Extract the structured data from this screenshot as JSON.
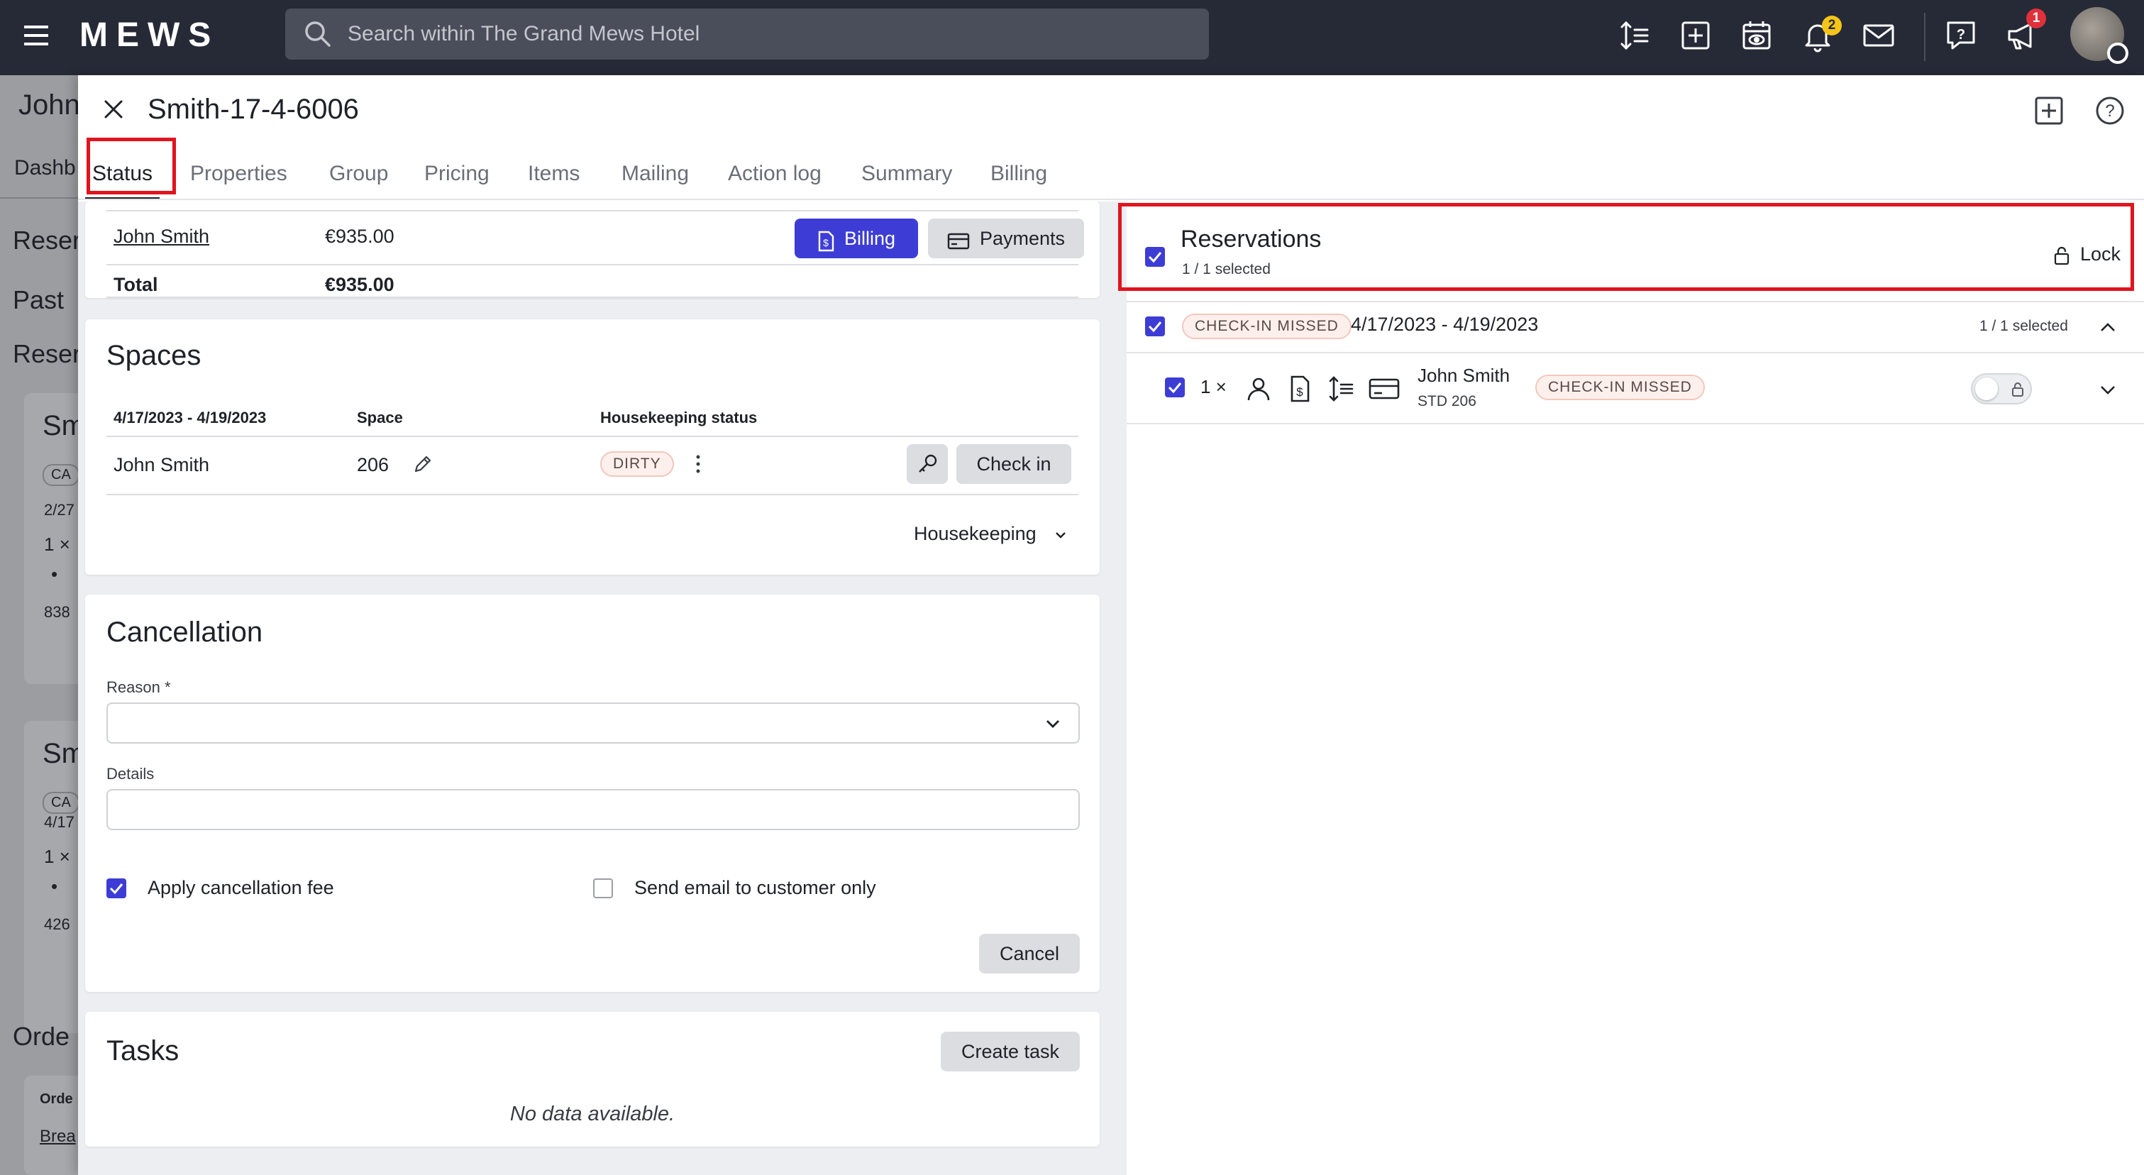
{
  "topbar": {
    "logo": "MEWS",
    "search_placeholder": "Search within The Grand Mews Hotel",
    "notifications_count": "2",
    "announcements_count": "1"
  },
  "background_page": {
    "guest_name": "John",
    "tab_dashboard": "Dashb",
    "section_1": "Reser",
    "section_2": "Past",
    "section_3": "Reser",
    "card1_title": "Sm",
    "card1_chip": "CA",
    "card1_date": "2/27",
    "card1_qty": "1 ×",
    "card1_amount": "838",
    "card2_title": "Sm",
    "card2_chip": "CA",
    "card2_date": "4/17",
    "card2_qty": "1 ×",
    "card2_amount": "426",
    "orders_heading": "Orde",
    "orders_col": "Orde",
    "orders_link": "Brea"
  },
  "panel": {
    "title": "Smith-17-4-6006",
    "tabs": [
      "Status",
      "Properties",
      "Group",
      "Pricing",
      "Items",
      "Mailing",
      "Action log",
      "Summary",
      "Billing"
    ],
    "billing_card": {
      "rows": [
        {
          "name": "John Smith",
          "amount": "€935.00"
        },
        {
          "name": "Total",
          "amount": "€935.00"
        }
      ],
      "billing_button": "Billing",
      "payments_button": "Payments"
    },
    "spaces_card": {
      "title": "Spaces",
      "headers": [
        "4/17/2023 - 4/19/2023",
        "Space",
        "Housekeeping status"
      ],
      "row": {
        "guest": "John Smith",
        "space": "206",
        "status": "DIRTY"
      },
      "check_in_button": "Check in",
      "housekeeping_dropdown": "Housekeeping"
    },
    "cancellation_card": {
      "title": "Cancellation",
      "reason_label": "Reason *",
      "details_label": "Details",
      "apply_fee_label": "Apply cancellation fee",
      "apply_fee_checked": true,
      "send_email_label": "Send email to customer only",
      "send_email_checked": false,
      "cancel_button": "Cancel"
    },
    "tasks_card": {
      "title": "Tasks",
      "create_button": "Create task",
      "empty_text": "No data available."
    }
  },
  "reservations_panel": {
    "title": "Reservations",
    "selected": "1 / 1 selected",
    "lock_label": "Lock",
    "group": {
      "status": "CHECK-IN MISSED",
      "dates": "4/17/2023 - 4/19/2023",
      "selected": "1 / 1 selected"
    },
    "item": {
      "qty": "1 ×",
      "guest": "John Smith",
      "room": "STD 206",
      "status": "CHECK-IN MISSED"
    }
  },
  "colors": {
    "topbar_bg": "#262a37",
    "primary": "#3d3dd6",
    "highlight": "#e0141e",
    "badge_yellow": "#f5c518",
    "badge_red": "#e0313b"
  }
}
